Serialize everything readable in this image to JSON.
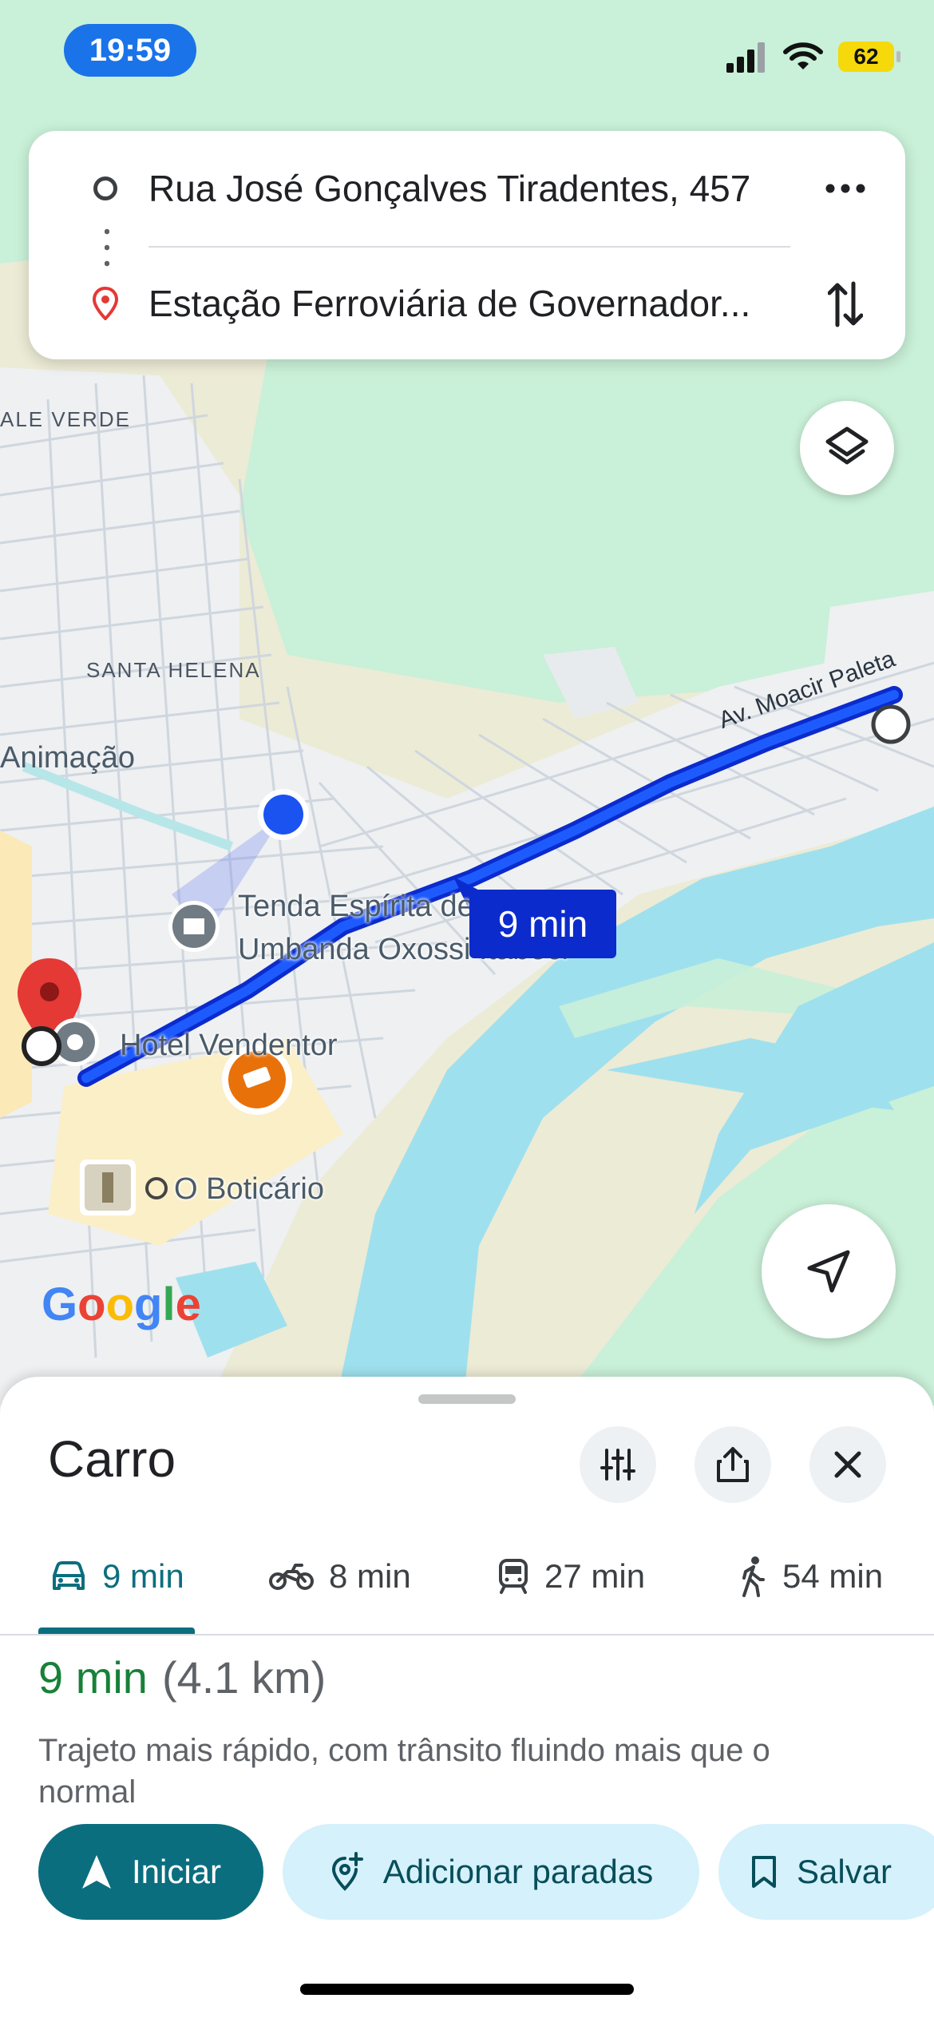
{
  "status_bar": {
    "time": "19:59",
    "battery": "62"
  },
  "search": {
    "origin": "Rua José Gonçalves Tiradentes, 457",
    "destination": "Estação Ferroviária de Governador..."
  },
  "map": {
    "labels": {
      "neighborhood_1": "ALE VERDE",
      "neighborhood_2": "SANTA HELENA",
      "place_1": "Animação",
      "street": "Av. Moacir Paleta"
    },
    "pois": {
      "tenda_line1": "Tenda Espírita de",
      "tenda_line2": "Umbanda Oxossi Itabeci",
      "hotel": "Hotel Vendentor",
      "boticario": "O Boticário"
    },
    "route_eta": "9 min",
    "logo": "Google",
    "colors": {
      "route": "#1227d6",
      "water": "#9fe0ee",
      "park": "#c9f0d8",
      "land": "#f1f3f4"
    }
  },
  "sheet": {
    "title": "Carro",
    "modes": [
      {
        "icon": "car-icon",
        "label": "9 min"
      },
      {
        "icon": "motorcycle-icon",
        "label": "8 min"
      },
      {
        "icon": "transit-icon",
        "label": "27 min"
      },
      {
        "icon": "walk-icon",
        "label": "54 min"
      }
    ],
    "eta_time": "9 min",
    "eta_distance": "(4.1 km)",
    "description": "Trajeto mais rápido, com trânsito fluindo mais que o normal",
    "buttons": {
      "start": "Iniciar",
      "add_stops": "Adicionar paradas",
      "save": "Salvar"
    },
    "accent_color": "#0b6e7f"
  }
}
